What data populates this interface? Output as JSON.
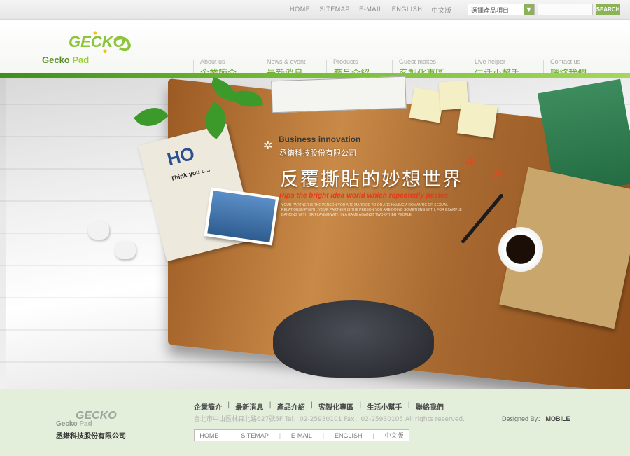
{
  "topbar": {
    "links": [
      "HOME",
      "SITEMAP",
      "E-MAIL",
      "ENGLISH",
      "中文版"
    ],
    "select_value": "選擇產品項目",
    "search_label": "SEARCH"
  },
  "logo": {
    "mark": "GECKO",
    "word1": "Gecko",
    "word2": "Pad"
  },
  "nav": [
    {
      "en": "About us",
      "zh": "企業簡介"
    },
    {
      "en": "News & event",
      "zh": "最新消息"
    },
    {
      "en": "Products",
      "zh": "產品介紹"
    },
    {
      "en": "Guest makes",
      "zh": "客製化專區"
    },
    {
      "en": "Live helper",
      "zh": "生活小幫手"
    },
    {
      "en": "Contact us",
      "zh": "聯絡我們"
    }
  ],
  "hero": {
    "business": "Business innovation",
    "company": "丞鐠科技股份有限公司",
    "headline": "反覆撕貼的妙想世界",
    "sub": "Rips the bright idea world which repeatedly pastes",
    "body": "YOUR PARTNER IS THE PERSON YOU ARE MARRIED TO OR ARE HAVING A ROMANTIC OR SEXUAL RELATIONSHIP WITH. YOUR PARTNER IS THE PERSON YOU ARE DOING SOMETHING WITH, FOR EXAMPLE DANCING WITH OR PLAYING WITH IN A GAME AGAINST TWO OTHER PEOPLE.",
    "newspaper_headline": "HO",
    "newspaper_sub": "Think you c..."
  },
  "footer": {
    "logo_word1": "Gecko",
    "logo_word2": "Pad",
    "company": "丞鐠科技股份有限公司",
    "nav": [
      "企業簡介",
      "最新消息",
      "產品介紹",
      "客製化專區",
      "生活小幫手",
      "聯絡我們"
    ],
    "address": "台北市中山區林森北路627號5F   Tel：02-25930101   Fax：02-25930105   All rights reserved.",
    "links": [
      "HOME",
      "SITEMAP",
      "E-MAIL",
      "ENGLISH",
      "中文版"
    ],
    "designed_by": "Designed By：",
    "designer": "MOBILE"
  },
  "colors": {
    "brand_green": "#6aa82a",
    "footer_bg": "#e3eedb",
    "search_button": "#8cb356"
  }
}
